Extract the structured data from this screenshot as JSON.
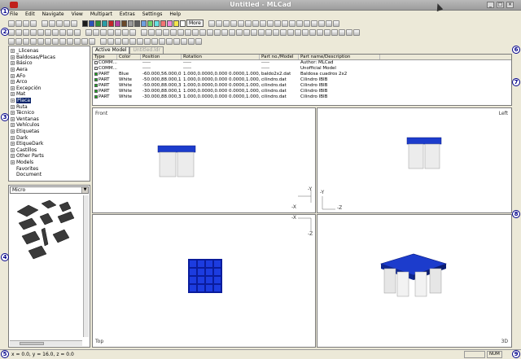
{
  "window": {
    "title": "Untitled - MLCad",
    "app_icon": "mlcad-logo-icon",
    "min": "_",
    "max": "□",
    "close": "×"
  },
  "menu": [
    "File",
    "Edit",
    "Navigate",
    "View",
    "Multipart",
    "Extras",
    "Settings",
    "Help"
  ],
  "toolbar": {
    "color_swatches": [
      "#1a1a1a",
      "#2e52b8",
      "#2f8f3a",
      "#2b9ea5",
      "#c2262a",
      "#b63fa0",
      "#6b4a2a",
      "#9a9a9a",
      "#5e5e5e",
      "#6fa0e0",
      "#6fd36c",
      "#67e0e0",
      "#f27474",
      "#f08ad9",
      "#f4e64a",
      "#ffffff"
    ],
    "more_label": "More"
  },
  "tree": {
    "items": [
      {
        "label": "_Llicenas",
        "expandable": true
      },
      {
        "label": "Baldosas/Placas",
        "expandable": true
      },
      {
        "label": "Básico",
        "expandable": true
      },
      {
        "label": "Aera",
        "expandable": true
      },
      {
        "label": "AFo",
        "expandable": true
      },
      {
        "label": "Arco",
        "expandable": true
      },
      {
        "label": "Excepción",
        "expandable": true
      },
      {
        "label": "Mat",
        "expandable": true
      },
      {
        "label": "Placa",
        "expandable": true,
        "selected": true
      },
      {
        "label": "Ruta",
        "expandable": true
      },
      {
        "label": "Técnico",
        "expandable": true
      },
      {
        "label": "Ventanas",
        "expandable": true
      },
      {
        "label": "Vehículos",
        "expandable": true
      },
      {
        "label": "Etiquetas",
        "expandable": true
      },
      {
        "label": "Dark",
        "expandable": true
      },
      {
        "label": "EtiqueDark",
        "expandable": true
      },
      {
        "label": "Castillos",
        "expandable": true
      },
      {
        "label": "Other Parts",
        "expandable": true
      },
      {
        "label": "Models",
        "expandable": true
      },
      {
        "label": "Favorites",
        "expandable": false
      },
      {
        "label": "Document",
        "expandable": false
      }
    ]
  },
  "preview": {
    "dropdown_value": "Micro"
  },
  "model_tabs": [
    "Active Model",
    "Untitled.ldr"
  ],
  "grid": {
    "headers": [
      "Type",
      "Color",
      "Position",
      "Rotation",
      "Part no./Model",
      "Part name/Description"
    ],
    "rows": [
      {
        "type": "COMM...",
        "color": "",
        "position": "-----",
        "rotation": "-----",
        "part": "-----",
        "desc": "Author: MLCad",
        "icon_color": "#ffffff"
      },
      {
        "type": "COMM...",
        "color": "",
        "position": "-----",
        "rotation": "-----",
        "part": "-----",
        "desc": "Unofficial Model",
        "icon_color": "#ffffff"
      },
      {
        "type": "PART",
        "color": "Blue",
        "position": "-60.000,56.000,0...",
        "rotation": "1.000,0.0000,0.000 0.0000,1.000,0.0000 0...",
        "part": "baldo2x2.dat",
        "desc": "Baldosa cuadros 2x2",
        "icon_color": "#19b51a"
      },
      {
        "type": "PART",
        "color": "White",
        "position": "-50.000,88.000,1...",
        "rotation": "1.000,0.0000,0.000 0.0000,1.000,0.0000 0...",
        "part": "cilindro.dat",
        "desc": "Cilindro     IBIB",
        "icon_color": "#19b51a"
      },
      {
        "type": "PART",
        "color": "White",
        "position": "-50.000,88.000,3...",
        "rotation": "1.000,0.0000,0.000 0.0000,1.000,0.0000 0...",
        "part": "cilindro.dat",
        "desc": "Cilindro     IBIB",
        "icon_color": "#19b51a"
      },
      {
        "type": "PART",
        "color": "White",
        "position": "-30.000,88.000,1...",
        "rotation": "1.000,0.0000,0.000 0.0000,1.000,0.0000 0...",
        "part": "cilindro.dat",
        "desc": "Cilindro     IBIB",
        "icon_color": "#19b51a"
      },
      {
        "type": "PART",
        "color": "White",
        "position": "-30.000,88.000,3...",
        "rotation": "1.000,0.0000,0.000 0.0000,1.000,0.0000 0...",
        "part": "cilindro.dat",
        "desc": "Cilindro     IBIB",
        "icon_color": "#19b51a"
      }
    ]
  },
  "viewports": {
    "front": "Front",
    "left": "Left",
    "top": "Top",
    "threed": "3D",
    "axis_front": {
      "x": "-X",
      "y": "-Y"
    },
    "axis_left": {
      "y": "-Y",
      "z": "-Z"
    },
    "axis_top": {
      "x": "-X",
      "z": "-Z"
    }
  },
  "status": {
    "coords": "x = 0.0, y = 16.0, z = 0.0",
    "num": "NUM"
  },
  "badges": [
    "1",
    "2",
    "3",
    "4",
    "5",
    "6",
    "7",
    "8",
    "9"
  ]
}
